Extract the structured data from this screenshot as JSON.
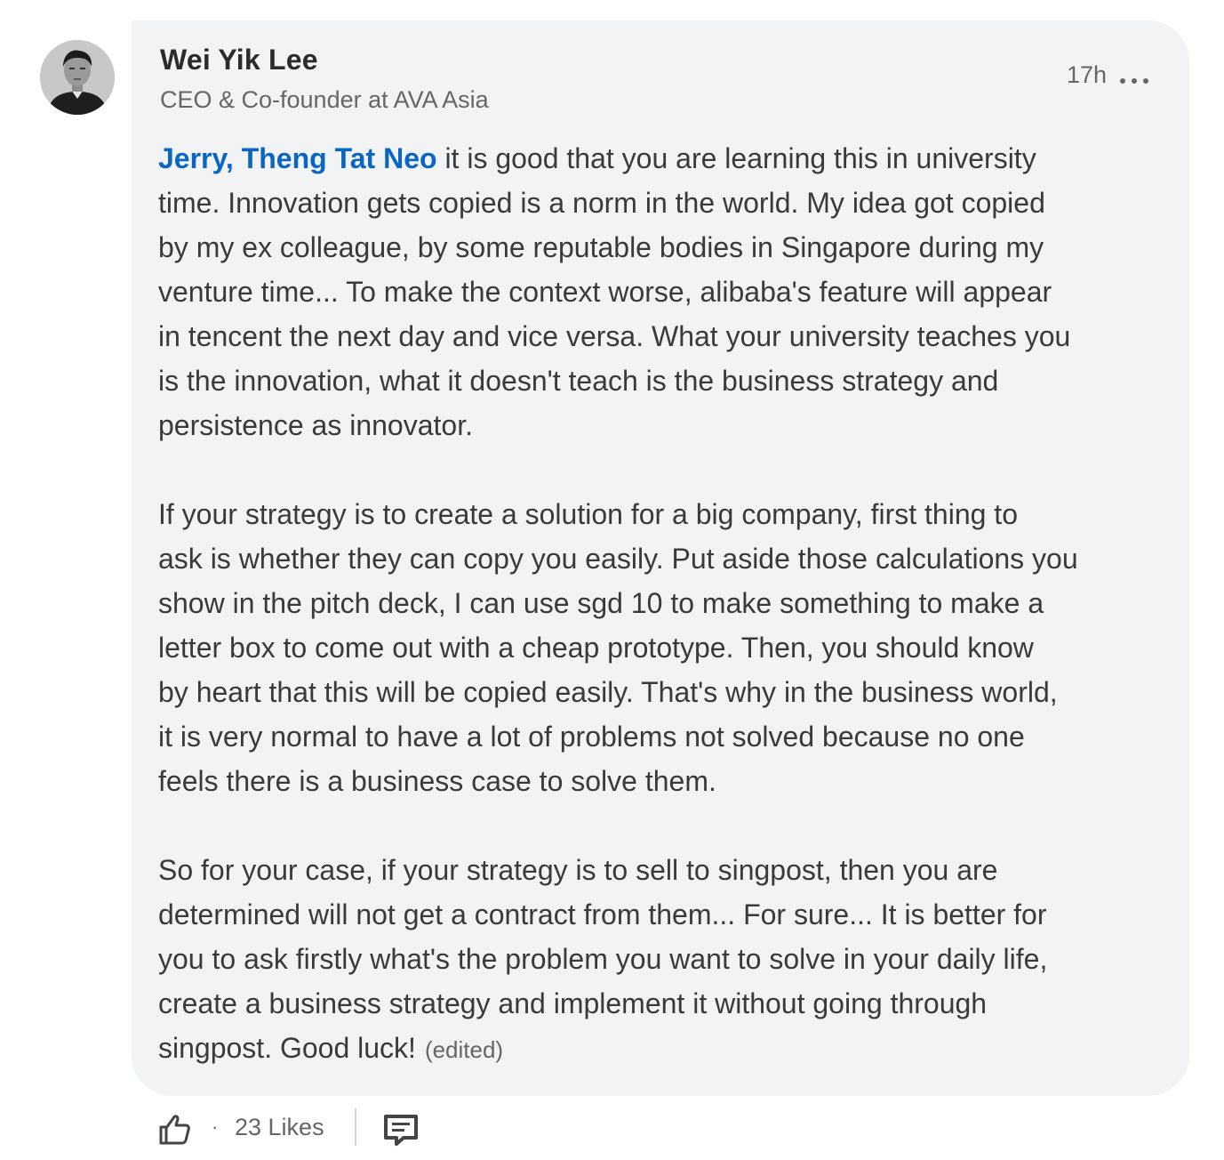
{
  "comment": {
    "author": {
      "name": "Wei Yik Lee",
      "headline": "CEO & Co-founder at AVA Asia"
    },
    "timestamp": "17h",
    "mention": "Jerry, Theng Tat Neo",
    "paragraphs": [
      [
        " it is good that you are learning this in university",
        "time. Innovation gets copied is a norm in the world. My idea got copied",
        "by my ex colleague, by some reputable bodies in Singapore during my",
        "venture time... To make the context worse, alibaba's feature will appear",
        "in tencent the next day and vice versa. What your university teaches you",
        "is the innovation, what it doesn't teach is the business strategy and",
        "persistence as innovator."
      ],
      [
        "If your strategy is to create a solution for a big company, first thing to",
        "ask is whether they can copy you easily. Put aside those calculations you",
        "show in the pitch deck, I can use sgd 10 to make something to make a",
        "letter box to come out with a cheap prototype. Then, you should know",
        "by heart that this will be copied easily. That's why in the business world,",
        "it is very normal to have a lot of problems not solved because no one",
        "feels there is a business case to solve them."
      ],
      [
        "So for your case, if your strategy is to sell to singpost, then you are",
        "determined will not get a contract from them... For sure... It is better for",
        "you to ask firstly what's the problem you want to solve in your daily life,",
        "create a business strategy and implement it without going through",
        "singpost. Good luck!"
      ]
    ],
    "edited_label": "(edited)"
  },
  "actions": {
    "separator": "·",
    "likes": "23 Likes"
  },
  "icons": {
    "avatar": "profile-photo",
    "more": "more-options-icon",
    "like": "like-thumb-icon",
    "reply": "reply-comment-icon"
  },
  "colors": {
    "mention": "#0a66c2",
    "bubble": "#f1f3f5",
    "text": "#3a3a3a",
    "muted": "#666666"
  }
}
